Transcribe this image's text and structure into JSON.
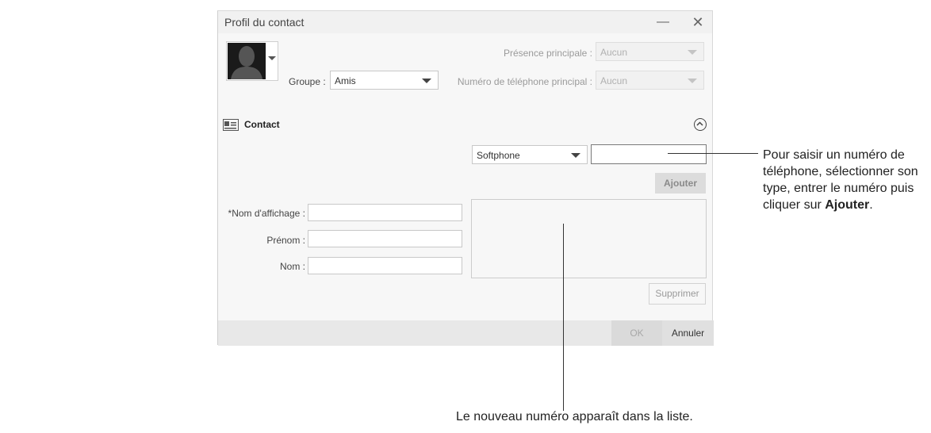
{
  "window": {
    "title": "Profil du contact",
    "minimize_symbol": "—",
    "close_symbol": "✕"
  },
  "header": {
    "presence_label": "Présence principale :",
    "presence_value": "Aucun",
    "group_label": "Groupe :",
    "group_value": "Amis",
    "phone_label": "Numéro de téléphone principal :",
    "phone_value": "Aucun"
  },
  "section": {
    "title": "Contact"
  },
  "phone_entry": {
    "type_value": "Softphone",
    "number_value": "",
    "add_label": "Ajouter",
    "delete_label": "Supprimer"
  },
  "fields": {
    "display_name_label": "*Nom d'affichage :",
    "display_name_value": "",
    "first_name_label": "Prénom :",
    "first_name_value": "",
    "last_name_label": "Nom :",
    "last_name_value": ""
  },
  "footer": {
    "ok_label": "OK",
    "cancel_label": "Annuler"
  },
  "annotations": {
    "right_text_1": "Pour saisir un numéro de téléphone, sélectionner son type, entrer le numéro puis cliquer sur ",
    "right_text_bold": "Ajouter",
    "right_text_end": ".",
    "bottom_text": "Le nouveau numéro apparaît dans la liste."
  }
}
